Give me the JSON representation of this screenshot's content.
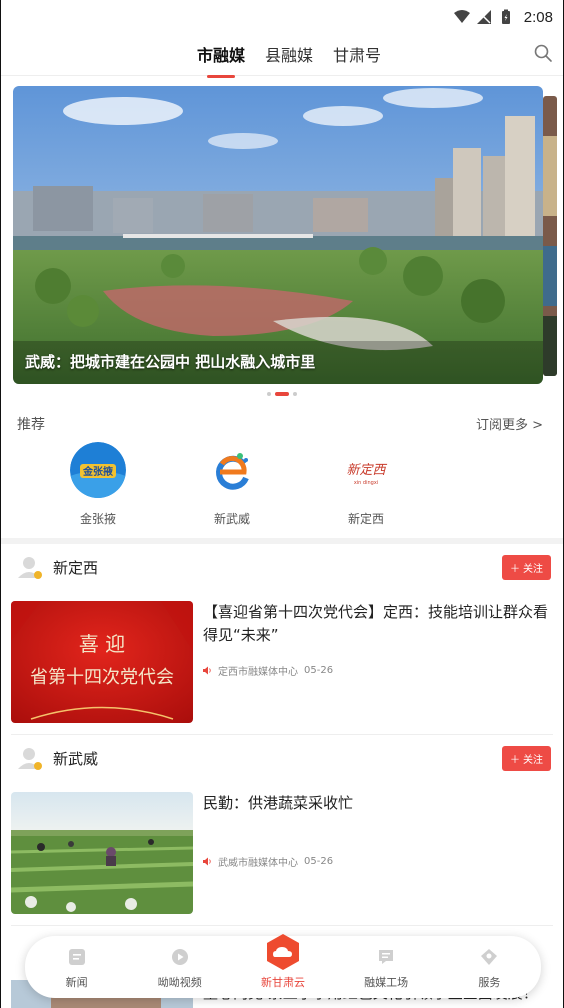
{
  "statusbar": {
    "time": "2:08"
  },
  "topnav": {
    "tabs": [
      {
        "label": "市融媒",
        "active": true
      },
      {
        "label": "县融媒",
        "active": false
      },
      {
        "label": "甘肃号",
        "active": false
      }
    ]
  },
  "banner": {
    "caption": "武威：把城市建在公园中 把山水融入城市里"
  },
  "recommend": {
    "title": "推荐",
    "more": "订阅更多 >",
    "items": [
      {
        "label": "金张掖",
        "logo_text": "金张掖"
      },
      {
        "label": "新武威"
      },
      {
        "label": "新定西",
        "logo_text": "新定西",
        "logo_sub": "xin dingxi"
      }
    ]
  },
  "feed": [
    {
      "source": "新定西",
      "follow": "关注",
      "title": "【喜迎省第十四次党代会】定西：技能培训让群众看得见“未来”",
      "thumb_text_1": "喜 迎",
      "thumb_text_2": "省第十四次党代会",
      "meta_source": "定西市融媒体中心",
      "date": "05-26"
    },
    {
      "source": "新武威",
      "follow": "关注",
      "title": "民勤：供港蔬菜采收忙",
      "meta_source": "武威市融媒体中心",
      "date": "05-26"
    }
  ],
  "peek_title": "童心向党 紫丘小学用红色文化引领学生全面发展！",
  "bottomnav": {
    "items": [
      {
        "label": "新闻",
        "icon": "news-icon"
      },
      {
        "label": "呦呦视频",
        "icon": "video-icon"
      },
      {
        "label": "新甘肃云",
        "icon": "cloud-icon",
        "active": true
      },
      {
        "label": "融媒工场",
        "icon": "factory-icon"
      },
      {
        "label": "服务",
        "icon": "service-icon"
      }
    ]
  },
  "colors": {
    "accent": "#e8463c",
    "follow": "#ee4b45"
  }
}
